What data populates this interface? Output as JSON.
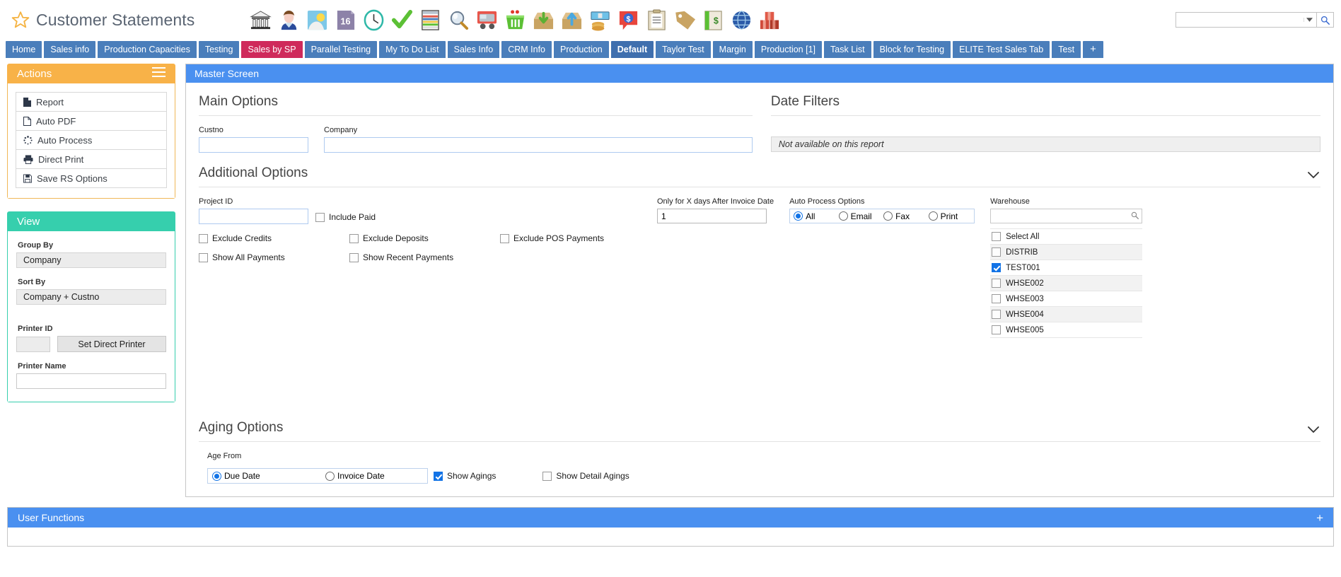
{
  "titlebar": {
    "star_icon": "star-icon",
    "app_title": "Customer Statements",
    "toolbar_icons": [
      {
        "name": "bank-icon",
        "glyph": "bank"
      },
      {
        "name": "contact-person-icon",
        "glyph": "person"
      },
      {
        "name": "weather-icon",
        "glyph": "weather"
      },
      {
        "name": "calendar-16-icon",
        "glyph": "calendar",
        "label": "16"
      },
      {
        "name": "clock-icon",
        "glyph": "clock"
      },
      {
        "name": "checkmark-icon",
        "glyph": "check"
      },
      {
        "name": "spreadsheet-icon",
        "glyph": "spreadsheet"
      },
      {
        "name": "magnifier-icon",
        "glyph": "magnifier"
      },
      {
        "name": "delivery-truck-icon",
        "glyph": "truck"
      },
      {
        "name": "shopping-basket-icon",
        "glyph": "basket"
      },
      {
        "name": "inbox-download-icon",
        "glyph": "download"
      },
      {
        "name": "outbox-upload-icon",
        "glyph": "upload"
      },
      {
        "name": "cash-payment-icon",
        "glyph": "cash"
      },
      {
        "name": "price-quote-icon",
        "glyph": "dollar-bubble"
      },
      {
        "name": "clipboard-notes-icon",
        "glyph": "clipboard"
      },
      {
        "name": "tag-label-icon",
        "glyph": "tag"
      },
      {
        "name": "money-book-icon",
        "glyph": "money-book"
      },
      {
        "name": "globe-network-icon",
        "glyph": "globe"
      },
      {
        "name": "warehouse-boxes-icon",
        "glyph": "boxes"
      }
    ],
    "search": {
      "value": "",
      "placeholder": "",
      "dropdown_icon": "chevron-down-icon",
      "go_icon": "search-icon"
    }
  },
  "tabs": [
    {
      "label": "Home",
      "state": "normal"
    },
    {
      "label": "Sales info",
      "state": "normal"
    },
    {
      "label": "Production Capacities",
      "state": "normal"
    },
    {
      "label": "Testing",
      "state": "normal"
    },
    {
      "label": "Sales by SP",
      "state": "highlight"
    },
    {
      "label": "Parallel Testing",
      "state": "normal"
    },
    {
      "label": "My To Do List",
      "state": "normal"
    },
    {
      "label": "Sales Info",
      "state": "normal"
    },
    {
      "label": "CRM Info",
      "state": "normal"
    },
    {
      "label": "Production",
      "state": "normal"
    },
    {
      "label": "Default",
      "state": "active"
    },
    {
      "label": "Taylor Test",
      "state": "normal"
    },
    {
      "label": "Margin",
      "state": "normal"
    },
    {
      "label": "Production [1]",
      "state": "normal"
    },
    {
      "label": "Task List",
      "state": "normal"
    },
    {
      "label": "Block for Testing",
      "state": "normal"
    },
    {
      "label": "ELITE Test Sales Tab",
      "state": "normal"
    },
    {
      "label": "Test",
      "state": "normal"
    }
  ],
  "tab_add_label": "+",
  "actions_panel": {
    "title": "Actions",
    "menu_icon": "hamburger-icon",
    "items": [
      {
        "label": "Report",
        "icon": "report-page-icon"
      },
      {
        "label": "Auto PDF",
        "icon": "pdf-file-icon"
      },
      {
        "label": "Auto Process",
        "icon": "spinner-icon"
      },
      {
        "label": "Direct Print",
        "icon": "printer-icon"
      },
      {
        "label": "Save RS Options",
        "icon": "save-floppy-icon"
      }
    ]
  },
  "view_panel": {
    "title": "View",
    "group_by": {
      "label": "Group By",
      "value": "Company"
    },
    "sort_by": {
      "label": "Sort By",
      "value": "Company + Custno"
    },
    "printer_id": {
      "label": "Printer ID",
      "value": ""
    },
    "set_direct_printer_label": "Set Direct Printer",
    "printer_name": {
      "label": "Printer Name",
      "value": ""
    }
  },
  "master": {
    "title": "Master Screen",
    "main_options": {
      "title": "Main Options",
      "custno": {
        "label": "Custno",
        "value": "",
        "placeholder": ""
      },
      "company": {
        "label": "Company",
        "value": "",
        "placeholder": ""
      }
    },
    "date_filters": {
      "title": "Date Filters",
      "note": "Not available on this report"
    },
    "additional_options": {
      "title": "Additional Options",
      "collapse_icon": "chevron-down-icon",
      "project_id": {
        "label": "Project ID",
        "value": "",
        "placeholder": ""
      },
      "include_paid": {
        "label": "Include Paid",
        "checked": false
      },
      "checkboxes_row1": [
        {
          "label": "Exclude Credits",
          "checked": false
        },
        {
          "label": "Exclude Deposits",
          "checked": false
        },
        {
          "label": "Exclude POS Payments",
          "checked": false
        }
      ],
      "checkboxes_row2": [
        {
          "label": "Show All Payments",
          "checked": false
        },
        {
          "label": "Show Recent Payments",
          "checked": false
        }
      ],
      "days_after_invoice": {
        "label": "Only for X days After Invoice Date",
        "value": "1"
      },
      "auto_process": {
        "label": "Auto Process Options",
        "options": [
          {
            "label": "All",
            "selected": true
          },
          {
            "label": "Email",
            "selected": false
          },
          {
            "label": "Fax",
            "selected": false
          },
          {
            "label": "Print",
            "selected": false
          }
        ]
      },
      "warehouse": {
        "label": "Warehouse",
        "search_value": "",
        "search_icon": "search-icon",
        "items": [
          {
            "label": "Select All",
            "checked": false
          },
          {
            "label": "DISTRIB",
            "checked": false
          },
          {
            "label": "TEST001",
            "checked": true
          },
          {
            "label": "WHSE002",
            "checked": false
          },
          {
            "label": "WHSE003",
            "checked": false
          },
          {
            "label": "WHSE004",
            "checked": false
          },
          {
            "label": "WHSE005",
            "checked": false
          }
        ]
      }
    },
    "aging_options": {
      "title": "Aging Options",
      "collapse_icon": "chevron-down-icon",
      "age_from": {
        "label": "Age From",
        "options": [
          {
            "label": "Due Date",
            "selected": true
          },
          {
            "label": "Invoice Date",
            "selected": false
          }
        ]
      },
      "show_agings": {
        "label": "Show Agings",
        "checked": true
      },
      "show_detail_agings": {
        "label": "Show Detail Agings",
        "checked": false
      }
    }
  },
  "user_functions": {
    "title": "User Functions",
    "add_icon": "plus-icon",
    "add_label": "+"
  }
}
